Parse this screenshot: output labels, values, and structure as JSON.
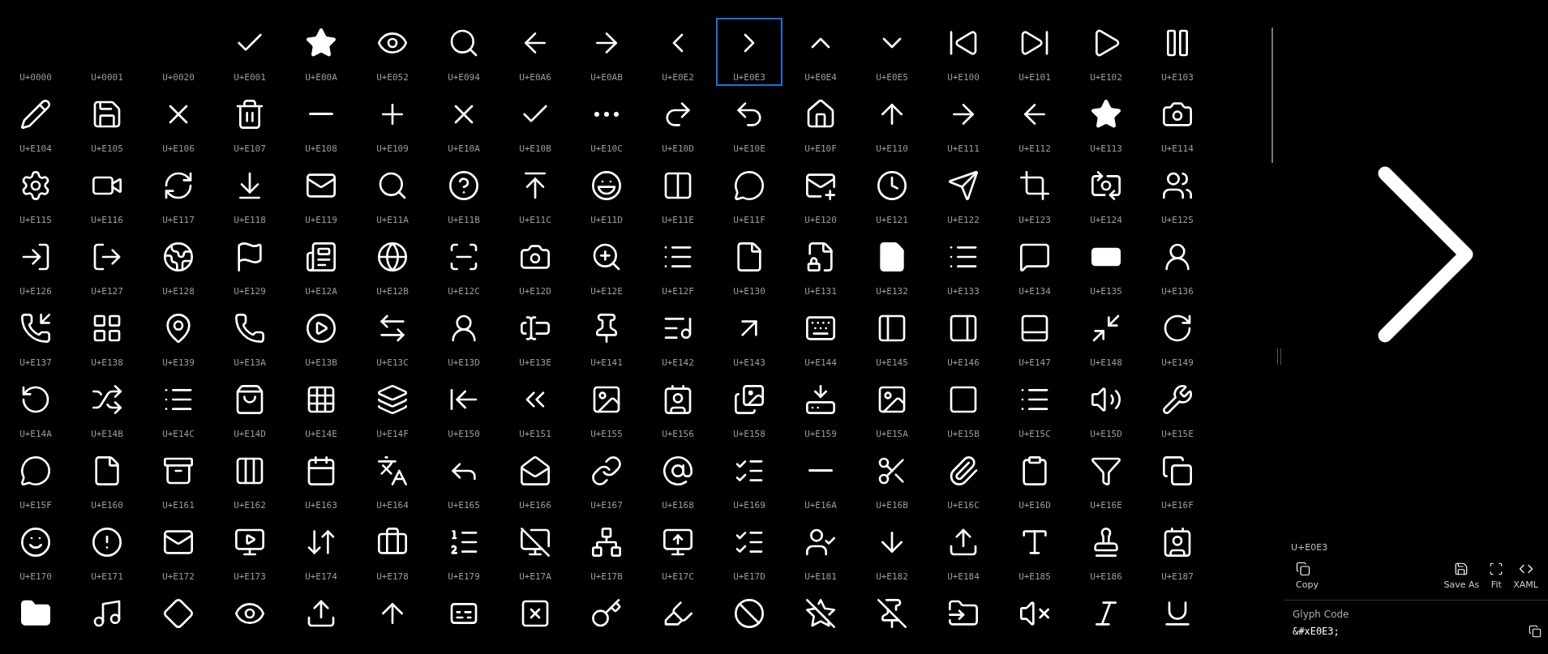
{
  "glyphs": [
    {
      "code": "U+0000",
      "selected": false
    },
    {
      "code": "U+0001",
      "selected": false
    },
    {
      "code": "U+0020",
      "selected": false
    },
    {
      "code": "U+E001",
      "selected": false
    },
    {
      "code": "U+E00A",
      "selected": false
    },
    {
      "code": "U+E052",
      "selected": false
    },
    {
      "code": "U+E094",
      "selected": false
    },
    {
      "code": "U+E0A6",
      "selected": false
    },
    {
      "code": "U+E0AB",
      "selected": false
    },
    {
      "code": "U+E0E2",
      "selected": false
    },
    {
      "code": "U+E0E3",
      "selected": true
    },
    {
      "code": "U+E0E4",
      "selected": false
    },
    {
      "code": "U+E0E5",
      "selected": false
    },
    {
      "code": "U+E100",
      "selected": false
    },
    {
      "code": "U+E101",
      "selected": false
    },
    {
      "code": "U+E102",
      "selected": false
    },
    {
      "code": "U+E103",
      "selected": false
    },
    {
      "code": "U+E104",
      "selected": false
    },
    {
      "code": "U+E105",
      "selected": false
    },
    {
      "code": "U+E106",
      "selected": false
    },
    {
      "code": "U+E107",
      "selected": false
    },
    {
      "code": "U+E108",
      "selected": false
    },
    {
      "code": "U+E109",
      "selected": false
    },
    {
      "code": "U+E10A",
      "selected": false
    },
    {
      "code": "U+E10B",
      "selected": false
    },
    {
      "code": "U+E10C",
      "selected": false
    },
    {
      "code": "U+E10D",
      "selected": false
    },
    {
      "code": "U+E10E",
      "selected": false
    },
    {
      "code": "U+E10F",
      "selected": false
    },
    {
      "code": "U+E110",
      "selected": false
    },
    {
      "code": "U+E111",
      "selected": false
    },
    {
      "code": "U+E112",
      "selected": false
    },
    {
      "code": "U+E113",
      "selected": false
    },
    {
      "code": "U+E114",
      "selected": false
    },
    {
      "code": "U+E115",
      "selected": false
    },
    {
      "code": "U+E116",
      "selected": false
    },
    {
      "code": "U+E117",
      "selected": false
    },
    {
      "code": "U+E118",
      "selected": false
    },
    {
      "code": "U+E119",
      "selected": false
    },
    {
      "code": "U+E11A",
      "selected": false
    },
    {
      "code": "U+E11B",
      "selected": false
    },
    {
      "code": "U+E11C",
      "selected": false
    },
    {
      "code": "U+E11D",
      "selected": false
    },
    {
      "code": "U+E11E",
      "selected": false
    },
    {
      "code": "U+E11F",
      "selected": false
    },
    {
      "code": "U+E120",
      "selected": false
    },
    {
      "code": "U+E121",
      "selected": false
    },
    {
      "code": "U+E122",
      "selected": false
    },
    {
      "code": "U+E123",
      "selected": false
    },
    {
      "code": "U+E124",
      "selected": false
    },
    {
      "code": "U+E125",
      "selected": false
    },
    {
      "code": "U+E126",
      "selected": false
    },
    {
      "code": "U+E127",
      "selected": false
    },
    {
      "code": "U+E128",
      "selected": false
    },
    {
      "code": "U+E129",
      "selected": false
    },
    {
      "code": "U+E12A",
      "selected": false
    },
    {
      "code": "U+E12B",
      "selected": false
    },
    {
      "code": "U+E12C",
      "selected": false
    },
    {
      "code": "U+E12D",
      "selected": false
    },
    {
      "code": "U+E12E",
      "selected": false
    },
    {
      "code": "U+E12F",
      "selected": false
    },
    {
      "code": "U+E130",
      "selected": false
    },
    {
      "code": "U+E131",
      "selected": false
    },
    {
      "code": "U+E132",
      "selected": false
    },
    {
      "code": "U+E133",
      "selected": false
    },
    {
      "code": "U+E134",
      "selected": false
    },
    {
      "code": "U+E135",
      "selected": false
    },
    {
      "code": "U+E136",
      "selected": false
    },
    {
      "code": "U+E137",
      "selected": false
    },
    {
      "code": "U+E138",
      "selected": false
    },
    {
      "code": "U+E139",
      "selected": false
    },
    {
      "code": "U+E13A",
      "selected": false
    },
    {
      "code": "U+E13B",
      "selected": false
    },
    {
      "code": "U+E13C",
      "selected": false
    },
    {
      "code": "U+E13D",
      "selected": false
    },
    {
      "code": "U+E13E",
      "selected": false
    },
    {
      "code": "U+E141",
      "selected": false
    },
    {
      "code": "U+E142",
      "selected": false
    },
    {
      "code": "U+E143",
      "selected": false
    },
    {
      "code": "U+E144",
      "selected": false
    },
    {
      "code": "U+E145",
      "selected": false
    },
    {
      "code": "U+E146",
      "selected": false
    },
    {
      "code": "U+E147",
      "selected": false
    },
    {
      "code": "U+E148",
      "selected": false
    },
    {
      "code": "U+E149",
      "selected": false
    },
    {
      "code": "U+E14A",
      "selected": false
    },
    {
      "code": "U+E14B",
      "selected": false
    },
    {
      "code": "U+E14C",
      "selected": false
    },
    {
      "code": "U+E14D",
      "selected": false
    },
    {
      "code": "U+E14E",
      "selected": false
    },
    {
      "code": "U+E14F",
      "selected": false
    },
    {
      "code": "U+E150",
      "selected": false
    },
    {
      "code": "U+E151",
      "selected": false
    },
    {
      "code": "U+E155",
      "selected": false
    },
    {
      "code": "U+E156",
      "selected": false
    },
    {
      "code": "U+E158",
      "selected": false
    },
    {
      "code": "U+E159",
      "selected": false
    },
    {
      "code": "U+E15A",
      "selected": false
    },
    {
      "code": "U+E15B",
      "selected": false
    },
    {
      "code": "U+E15C",
      "selected": false
    },
    {
      "code": "U+E15D",
      "selected": false
    },
    {
      "code": "U+E15E",
      "selected": false
    },
    {
      "code": "U+E15F",
      "selected": false
    },
    {
      "code": "U+E160",
      "selected": false
    },
    {
      "code": "U+E161",
      "selected": false
    },
    {
      "code": "U+E162",
      "selected": false
    },
    {
      "code": "U+E163",
      "selected": false
    },
    {
      "code": "U+E164",
      "selected": false
    },
    {
      "code": "U+E165",
      "selected": false
    },
    {
      "code": "U+E166",
      "selected": false
    },
    {
      "code": "U+E167",
      "selected": false
    },
    {
      "code": "U+E168",
      "selected": false
    },
    {
      "code": "U+E169",
      "selected": false
    },
    {
      "code": "U+E16A",
      "selected": false
    },
    {
      "code": "U+E16B",
      "selected": false
    },
    {
      "code": "U+E16C",
      "selected": false
    },
    {
      "code": "U+E16D",
      "selected": false
    },
    {
      "code": "U+E16E",
      "selected": false
    },
    {
      "code": "U+E16F",
      "selected": false
    },
    {
      "code": "U+E170",
      "selected": false
    },
    {
      "code": "U+E171",
      "selected": false
    },
    {
      "code": "U+E172",
      "selected": false
    },
    {
      "code": "U+E173",
      "selected": false
    },
    {
      "code": "U+E174",
      "selected": false
    },
    {
      "code": "U+E178",
      "selected": false
    },
    {
      "code": "U+E179",
      "selected": false
    },
    {
      "code": "U+E17A",
      "selected": false
    },
    {
      "code": "U+E17B",
      "selected": false
    },
    {
      "code": "U+E17C",
      "selected": false
    },
    {
      "code": "U+E17D",
      "selected": false
    },
    {
      "code": "U+E181",
      "selected": false
    },
    {
      "code": "U+E182",
      "selected": false
    },
    {
      "code": "U+E184",
      "selected": false
    },
    {
      "code": "U+E185",
      "selected": false
    },
    {
      "code": "U+E186",
      "selected": false
    },
    {
      "code": "U+E187",
      "selected": false
    }
  ],
  "details": {
    "code": "U+E0E3",
    "actions": [
      {
        "kind": "copy",
        "label": "Copy"
      },
      {
        "kind": "save",
        "label": "Save As"
      },
      {
        "kind": "fit",
        "label": "Fit"
      },
      {
        "kind": "xaml",
        "label": "XAML"
      }
    ],
    "glyph_code_label": "Glyph Code",
    "glyph_code": "&#xE0E3;"
  }
}
